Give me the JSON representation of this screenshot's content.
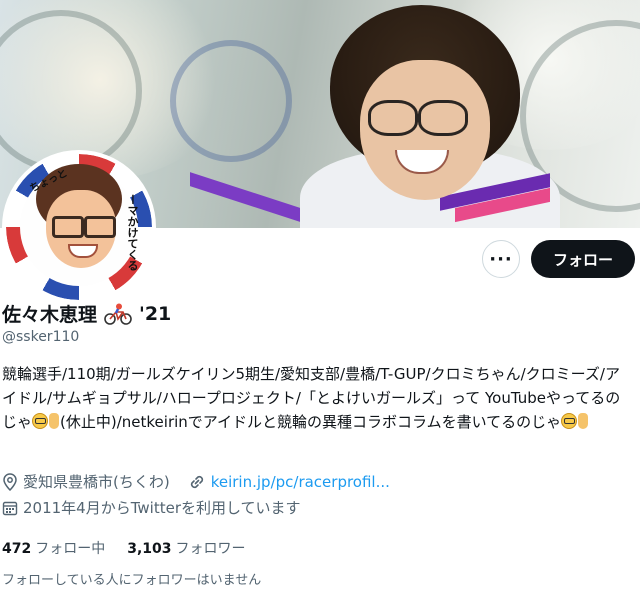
{
  "profile": {
    "display_name": "佐々木恵理",
    "name_suffix": "'21",
    "handle": "@ssker110",
    "bio": "競輪選手/110期/ガールズケイリン5期生/愛知支部/豊橋/T-GUP/クロミちゃん/クロミーズ/アイドル/サムギョプサル/ハロープロジェクト/「とよけいガールズ」って YouTubeやってるのじゃ",
    "bio_part2": "(休止中)/netkeirinでアイドルと競輪の異種コラボコラムを書いてるのじゃ",
    "location": "愛知県豊橋市(ちくわ)",
    "website": "keirin.jp/pc/racerprofil...",
    "joined": "2011年4月からTwitterを利用しています"
  },
  "avatar_text": {
    "top": "ちょっと",
    "side": "ーマかけてくる"
  },
  "buttons": {
    "more": "···",
    "follow": "フォロー"
  },
  "stats": {
    "following_count": "472",
    "following_label": "フォロー中",
    "followers_count": "3,103",
    "followers_label": "フォロワー"
  },
  "followers_you_know": "フォローしている人にフォロワーはいません",
  "colors": {
    "text": "#0f1419",
    "secondary": "#536471",
    "link": "#1d9bf0",
    "follow_bg": "#0f1419"
  },
  "icons": [
    "location-pin-icon",
    "link-icon",
    "calendar-icon",
    "bicycle-emoji-icon",
    "glasses-face-emoji-icon",
    "pointing-hand-emoji-icon"
  ]
}
